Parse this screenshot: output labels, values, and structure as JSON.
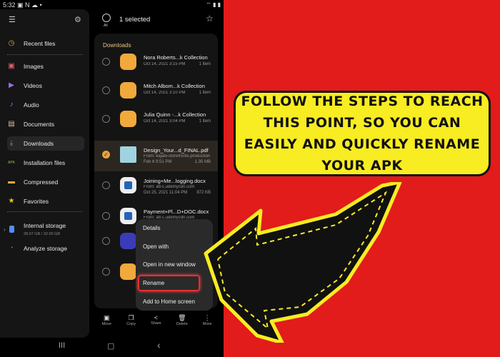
{
  "status": {
    "time": "5:32",
    "icons": "▣ N ☁ •",
    "right": "⌔ ▮ ▮"
  },
  "header": {
    "selected": "1 selected",
    "all": "All"
  },
  "drawer": {
    "items": [
      {
        "label": "Recent files",
        "icon": "clock-icon",
        "color": "#e9a23b"
      },
      {
        "label": "Images",
        "icon": "image-icon",
        "color": "#e35d6a"
      },
      {
        "label": "Videos",
        "icon": "video-icon",
        "color": "#9b6cf0"
      },
      {
        "label": "Audio",
        "icon": "music-icon",
        "color": "#6d8df0"
      },
      {
        "label": "Documents",
        "icon": "document-icon",
        "color": "#d9c09a"
      },
      {
        "label": "Downloads",
        "icon": "download-icon",
        "color": "#4bb38a"
      },
      {
        "label": "Installation files",
        "icon": "apk-icon",
        "color": "#8bc34a"
      },
      {
        "label": "Compressed",
        "icon": "archive-icon",
        "color": "#f0a93a"
      },
      {
        "label": "Favorites",
        "icon": "star-icon",
        "color": "#f5c518"
      }
    ],
    "storage": {
      "label": "Internal storage",
      "size": "28.97 GB / 32.00 GB"
    },
    "analyze": "Analyze storage"
  },
  "list": {
    "title": "Downloads",
    "files": [
      {
        "name": "Nora Roberts...k Collection",
        "date": "Oct 14, 2021 3:15 PM",
        "size": "1 item",
        "type": "folder"
      },
      {
        "name": "Mitch Albom...k Collection",
        "date": "Oct 14, 2021 3:10 PM",
        "size": "1 item",
        "type": "folder"
      },
      {
        "name": "Julia Quinn -...k Collection",
        "date": "Oct 14, 2021 3:04 PM",
        "size": "1 item",
        "type": "folder"
      },
      {
        "name": "Design_Your...d_FINAL.pdf",
        "from": "From: kajabi-storefronts-production",
        "date": "Feb 6 9:51 PM",
        "size": "1.35 MB",
        "type": "pdf",
        "selected": true
      },
      {
        "name": "Joining+Me...logging.docx",
        "from": "From: att-c.udemycdn.com",
        "date": "Oct 25, 2021 11:04 PM",
        "size": "872 KB",
        "type": "word"
      },
      {
        "name": "Payment+Pl...D+DOC.docx",
        "from": "From: att-c.udemycdn.com",
        "type": "word"
      }
    ]
  },
  "menu": [
    "Details",
    "Open with",
    "Open in new window",
    "Rename",
    "Add to Home screen"
  ],
  "actions": [
    {
      "label": "Move",
      "icon": "▣"
    },
    {
      "label": "Copy",
      "icon": "❐"
    },
    {
      "label": "Share",
      "icon": "<"
    },
    {
      "label": "Delete",
      "icon": "🗑"
    },
    {
      "label": "More",
      "icon": "⋮"
    }
  ],
  "navbar": {
    "recents": "III",
    "home": "▢",
    "back": "‹"
  },
  "callout": "Follow the steps to reach this point, so you can easily and quickly rename your APK",
  "colors": {
    "red": "#e21b1b",
    "yellow": "#f8ec22",
    "accent": "#e9a23b"
  }
}
